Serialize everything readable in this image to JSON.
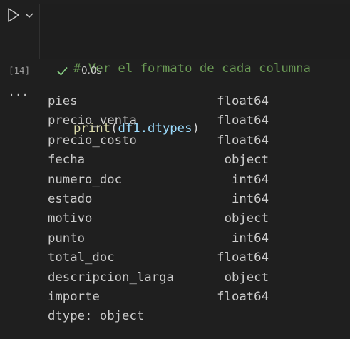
{
  "cell": {
    "execution_count": "[14]",
    "code": {
      "comment": "# Ver el formato de cada columna",
      "fn": "print",
      "open_paren": "(",
      "arg": "df1.dtypes",
      "close_paren": ")"
    },
    "status": {
      "icon": "check-icon",
      "duration": "0.0s",
      "color": "#89d185"
    },
    "toolbar": {
      "run_icon": "run-icon",
      "menu_icon": "chevron-down-icon"
    }
  },
  "output": {
    "more_icon_text": "···",
    "rows": [
      {
        "name": "pies",
        "dtype": "float64"
      },
      {
        "name": "precio_venta",
        "dtype": "float64"
      },
      {
        "name": "precio_costo",
        "dtype": "float64"
      },
      {
        "name": "fecha",
        "dtype": "object"
      },
      {
        "name": "numero_doc",
        "dtype": "int64"
      },
      {
        "name": "estado",
        "dtype": "int64"
      },
      {
        "name": "motivo",
        "dtype": "object"
      },
      {
        "name": "punto",
        "dtype": "int64"
      },
      {
        "name": "total_doc",
        "dtype": "float64"
      },
      {
        "name": "descripcion_larga",
        "dtype": "object"
      },
      {
        "name": "importe",
        "dtype": "float64"
      }
    ],
    "footer": "dtype: object"
  }
}
